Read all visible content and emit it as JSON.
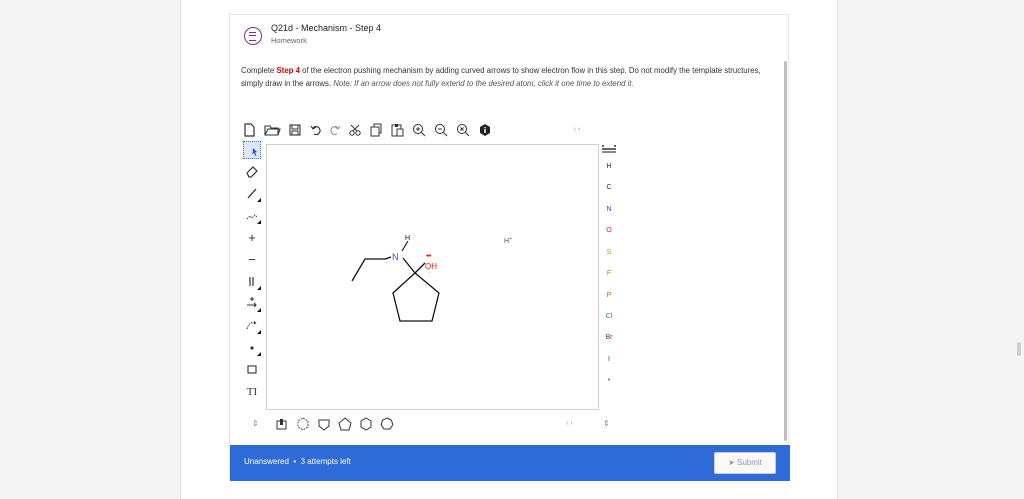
{
  "question": {
    "title": "Q21d - Mechanism - Step 4",
    "type": "Homework",
    "text_prefix": "Complete ",
    "text_step": "Step 4",
    "text_body": " of the electron pushing mechanism by adding curved arrows to show electron flow in this step. Do not modify the template structures, simply draw in the arrows. ",
    "text_note": "Note: If an arrow does not fully extend to the desired atom, click it one time to extend it."
  },
  "toolbar": {
    "icons": [
      "new-document-icon",
      "open-folder-icon",
      "save-icon",
      "undo-icon",
      "redo-icon",
      "cut-icon",
      "copy-icon",
      "paste-icon",
      "zoom-in-icon",
      "zoom-out-icon",
      "zoom-reset-icon",
      "info-icon"
    ],
    "expand_glyph": "‹ ›"
  },
  "left_tools": {
    "icons": [
      "selection-tool-icon",
      "eraser-icon",
      "single-bond-icon",
      "chain-icon",
      "charge-plus-icon",
      "charge-minus-icon",
      "bond-types-icon",
      "reaction-arrow-icon",
      "curved-arrow-icon",
      "electron-dot-icon",
      "rectangle-icon",
      "text-tool-icon"
    ]
  },
  "right_tools": {
    "periodic_table_icon": "periodic-table-icon",
    "elements": [
      "H",
      "C",
      "N",
      "O",
      "S",
      "F",
      "P",
      "Cl",
      "Br",
      "I",
      "*"
    ],
    "element_colors": {
      "H": "#333333",
      "C": "#333333",
      "N": "#2a4fd6",
      "O": "#e02020",
      "S": "#b59a00",
      "F": "#c08000",
      "P": "#d06000",
      "Cl": "#1a9a1a",
      "Br": "#8a2a2a",
      "I": "#7a1a8a",
      "*": "#333333"
    }
  },
  "molecule": {
    "atom_labels": [
      "N",
      "H",
      "OH"
    ],
    "hydrogen_ion": "H",
    "hydrogen_ion_charge": "+"
  },
  "bottom_templates": {
    "icons": [
      "template-menu-icon",
      "benzene-ring-icon",
      "cyclopropane-ring-icon",
      "cyclobutane-ring-icon",
      "cyclopentane-ring-icon",
      "cyclohexane-ring-icon",
      "cycloheptane-ring-icon"
    ]
  },
  "footer": {
    "status": "Unanswered",
    "attempts": "3 attempts left",
    "submit_label": "Submit"
  }
}
